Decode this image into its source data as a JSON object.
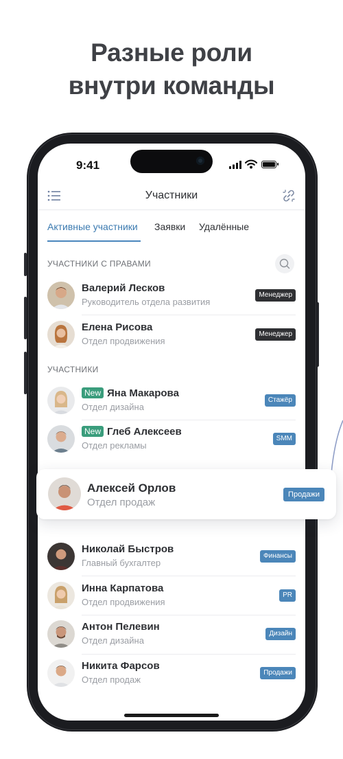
{
  "headline": {
    "line1": "Разные роли",
    "line2": "внутри команды"
  },
  "status_bar": {
    "time": "9:41"
  },
  "nav": {
    "title": "Участники",
    "left_icon": "list-menu-icon",
    "right_icon": "link-icon"
  },
  "tabs": [
    {
      "label": "Активные участники",
      "active": true
    },
    {
      "label": "Заявки",
      "active": false
    },
    {
      "label": "Удалённые",
      "active": false
    }
  ],
  "sections": {
    "privileged": "УЧАСТНИКИ С ПРАВАМИ",
    "members": "УЧАСТНИКИ"
  },
  "new_label": "New",
  "privileged_members": [
    {
      "name": "Валерий Лесков",
      "dept": "Руководитель отдела развития",
      "role": "Менеджер"
    },
    {
      "name": "Елена Рисова",
      "dept": "Отдел продвижения",
      "role": "Менеджер"
    }
  ],
  "members": [
    {
      "name": "Яна Макарова",
      "dept": "Отдел дизайна",
      "role": "Стажёр",
      "is_new": true
    },
    {
      "name": "Глеб Алексеев",
      "dept": "Отдел рекламы",
      "role": "SMM",
      "is_new": true
    },
    {
      "name": "Николай Быстров",
      "dept": "Главный бухгалтер",
      "role": "Финансы",
      "is_new": false
    },
    {
      "name": "Инна Карпатова",
      "dept": "Отдел продвижения",
      "role": "PR",
      "is_new": false
    },
    {
      "name": "Антон Пелевин",
      "dept": "Отдел дизайна",
      "role": "Дизайн",
      "is_new": false
    },
    {
      "name": "Никита Фарсов",
      "dept": "Отдел продаж",
      "role": "Продажи",
      "is_new": false
    }
  ],
  "highlighted_member": {
    "name": "Алексей Орлов",
    "dept": "Отдел продаж",
    "role": "Продажи"
  },
  "colors": {
    "accent": "#4a86bd",
    "new_badge": "#3a9d7c",
    "manager_badge": "#2f3033"
  }
}
